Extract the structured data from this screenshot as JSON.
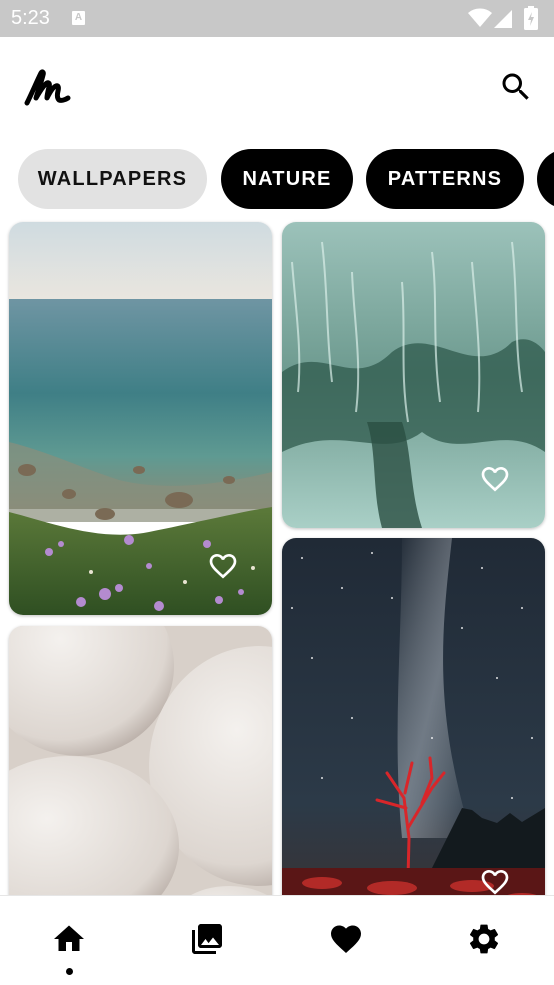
{
  "status_bar": {
    "time": "5:23",
    "notification_icon": "a-letter-icon",
    "icons": [
      "wifi-icon",
      "signal-icon",
      "battery-icon"
    ]
  },
  "header": {
    "logo_icon": "signature-logo-icon",
    "search_icon": "search-icon"
  },
  "categories": [
    {
      "label": "WALLPAPERS",
      "selected": false
    },
    {
      "label": "NATURE",
      "selected": true
    },
    {
      "label": "PATTERNS",
      "selected": true
    }
  ],
  "wallpapers": [
    {
      "subject": "coastal sea",
      "favorite_icon": "heart-outline-icon"
    },
    {
      "subject": "green abstract blur",
      "favorite_icon": "heart-outline-icon"
    },
    {
      "subject": "white spheres",
      "favorite_icon": "heart-outline-icon"
    },
    {
      "subject": "milky way red tree",
      "favorite_icon": "heart-outline-icon"
    }
  ],
  "bottom_nav": {
    "items": [
      {
        "icon": "home-icon",
        "active": true
      },
      {
        "icon": "gallery-icon",
        "active": false
      },
      {
        "icon": "heart-icon",
        "active": false
      },
      {
        "icon": "settings-gear-icon",
        "active": false
      }
    ]
  },
  "colors": {
    "chip_active_bg": "#000000",
    "chip_inactive_bg": "#e2e2e2",
    "status_bar_bg": "#c8c8c8"
  }
}
